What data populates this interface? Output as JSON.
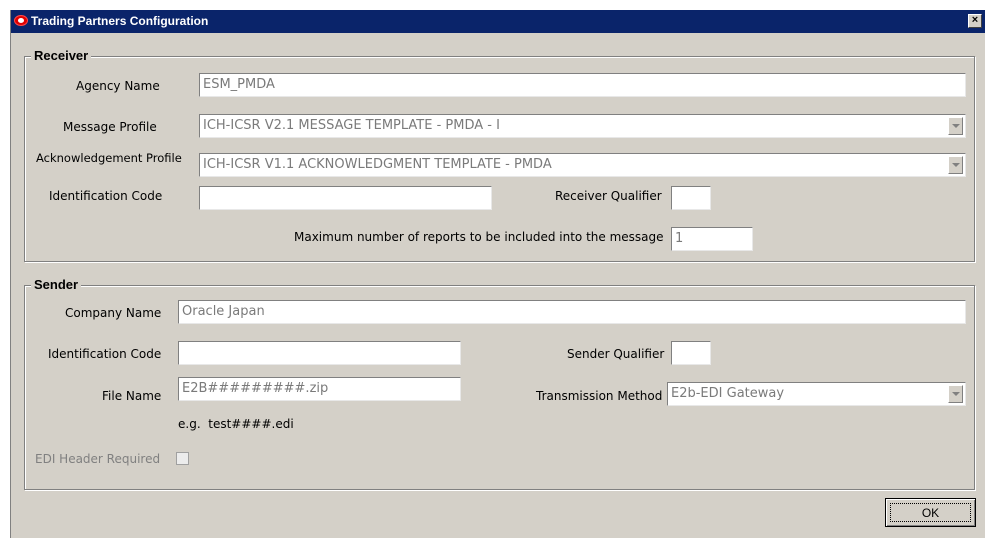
{
  "window": {
    "title": "Trading Partners Configuration",
    "close_glyph": "×",
    "app_icon": "oracle-logo-icon",
    "title_bar_color": "#0a246a"
  },
  "receiver": {
    "legend": "Receiver",
    "agency_name_label": "Agency Name",
    "agency_name_value": "ESM_PMDA",
    "message_profile_label": "Message Profile",
    "message_profile_value": "ICH-ICSR V2.1 MESSAGE TEMPLATE - PMDA - I",
    "ack_profile_label": "Acknowledgement Profile",
    "ack_profile_value": "ICH-ICSR V1.1 ACKNOWLEDGMENT TEMPLATE - PMDA",
    "identification_code_label": "Identification Code",
    "identification_code_value": "",
    "receiver_qualifier_label": "Receiver Qualifier",
    "receiver_qualifier_value": "",
    "max_reports_label": "Maximum number of reports to be included into the message",
    "max_reports_value": "1"
  },
  "sender": {
    "legend": "Sender",
    "company_name_label": "Company Name",
    "company_name_value": "Oracle Japan",
    "identification_code_label": "Identification Code",
    "identification_code_value": "",
    "sender_qualifier_label": "Sender Qualifier",
    "sender_qualifier_value": "",
    "file_name_label": "File Name",
    "file_name_value": "E2B#########.zip",
    "file_name_hint": "e.g.  test####.edi",
    "transmission_method_label": "Transmission Method",
    "transmission_method_value": "E2b-EDI Gateway",
    "edi_header_label": "EDI Header Required",
    "edi_header_checked": false
  },
  "buttons": {
    "ok_label": "OK"
  }
}
